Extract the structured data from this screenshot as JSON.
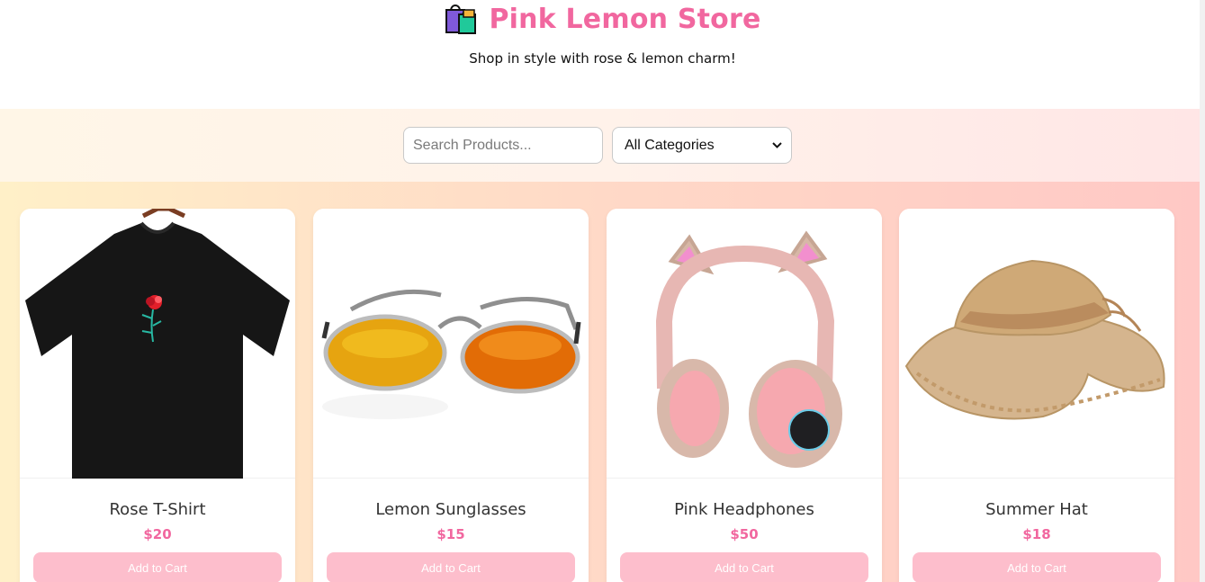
{
  "header": {
    "title": "Pink Lemon Store",
    "tagline": "Shop in style with rose & lemon charm!",
    "icon": "shopping-bags-icon"
  },
  "filters": {
    "search_placeholder": "Search Products...",
    "search_value": "",
    "category_selected": "All Categories"
  },
  "colors": {
    "brand_pink": "#f1679f",
    "button_pink": "#fdbecc"
  },
  "products": [
    {
      "name": "Rose T-Shirt",
      "price": "$20",
      "button": "Add to Cart",
      "image": "black-rose-t-shirt-image"
    },
    {
      "name": "Lemon Sunglasses",
      "price": "$15",
      "button": "Add to Cart",
      "image": "aviator-sunglasses-image"
    },
    {
      "name": "Pink Headphones",
      "price": "$50",
      "button": "Add to Cart",
      "image": "cat-ear-headphones-image"
    },
    {
      "name": "Summer Hat",
      "price": "$18",
      "button": "Add to Cart",
      "image": "straw-sun-hat-image"
    }
  ]
}
